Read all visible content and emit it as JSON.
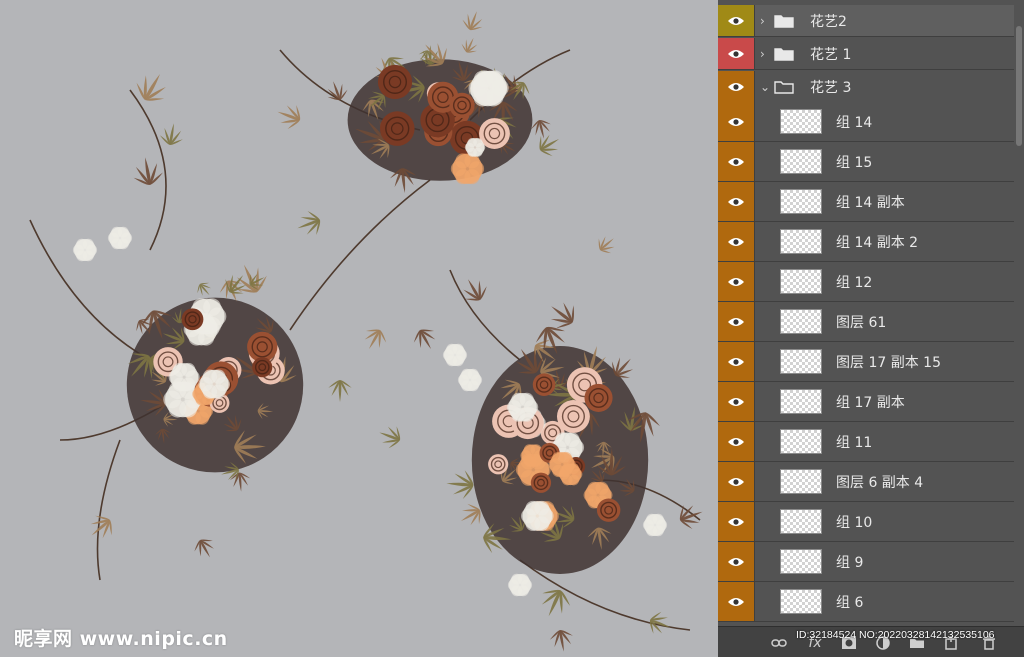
{
  "watermark": {
    "text": "昵享网 www.nipic.cn"
  },
  "layers_panel": {
    "groups": [
      {
        "name": "花艺2",
        "collapsed": true,
        "eye_color": "#a08a16",
        "selected": true
      },
      {
        "name": "花艺 1",
        "collapsed": true,
        "eye_color": "#c94a4a",
        "selected": false
      },
      {
        "name": "花艺 3",
        "collapsed": false,
        "eye_color": "#b0690e",
        "selected": false
      }
    ],
    "layers": [
      {
        "name": "组 14"
      },
      {
        "name": "组 15"
      },
      {
        "name": "组 14 副本"
      },
      {
        "name": "组 14 副本 2"
      },
      {
        "name": "组 12"
      },
      {
        "name": "图层 61"
      },
      {
        "name": "图层 17 副本 15"
      },
      {
        "name": "组 17 副本"
      },
      {
        "name": "组 11"
      },
      {
        "name": "图层 6 副本 4"
      },
      {
        "name": "组 10"
      },
      {
        "name": "组 9"
      },
      {
        "name": "组 6"
      }
    ],
    "layer_eye_color": "#b0690e",
    "footer": {
      "tools": [
        "link-icon",
        "fx-icon",
        "mask-icon",
        "adjustment-icon",
        "folder-icon",
        "new-layer-icon",
        "trash-icon"
      ],
      "fx_label": "fx",
      "id_text": "ID:32184524 NO:20220328142132535106"
    }
  },
  "colors": {
    "canvas_bg": "#b4b5b8",
    "panel_bg": "#535353",
    "rose_dark": "#7a3a24",
    "rose_rust": "#9a5032",
    "peach": "#f2a66a",
    "blush": "#ecc3b3",
    "white_flower": "#efede6",
    "leaf_brown": "#6e4a36",
    "leaf_olive": "#7d7443",
    "leaf_tan": "#a07d57"
  }
}
